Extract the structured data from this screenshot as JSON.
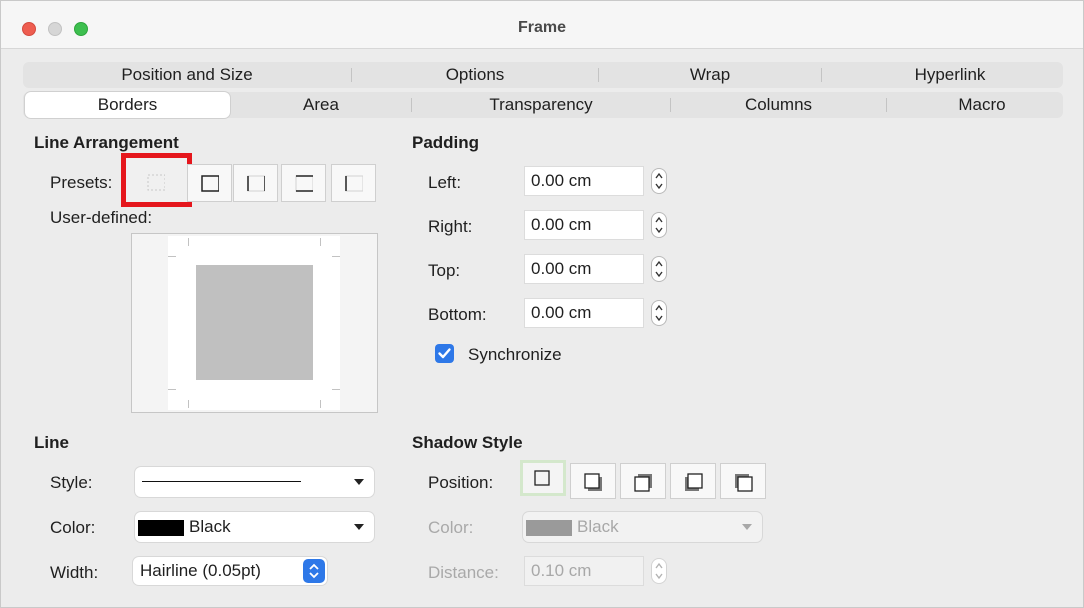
{
  "window": {
    "title": "Frame"
  },
  "tabs": {
    "row1": [
      "Position and Size",
      "Options",
      "Wrap",
      "Hyperlink"
    ],
    "row2": [
      "Borders",
      "Area",
      "Transparency",
      "Columns",
      "Macro"
    ],
    "active": "Borders"
  },
  "line_arrangement": {
    "title": "Line Arrangement",
    "presets_label": "Presets:",
    "presets": [
      "no-borders-icon",
      "all-borders-icon",
      "left-right-borders-icon",
      "top-bottom-borders-icon",
      "left-border-icon"
    ],
    "user_defined_label": "User-defined:"
  },
  "padding": {
    "title": "Padding",
    "left_label": "Left:",
    "left_value": "0.00 cm",
    "right_label": "Right:",
    "right_value": "0.00 cm",
    "top_label": "Top:",
    "top_value": "0.00 cm",
    "bottom_label": "Bottom:",
    "bottom_value": "0.00 cm",
    "synchronize_label": "Synchronize",
    "synchronize_checked": true
  },
  "line": {
    "title": "Line",
    "style_label": "Style:",
    "color_label": "Color:",
    "color_value": "Black",
    "color_hex": "#000000",
    "width_label": "Width:",
    "width_value": "Hairline (0.05pt)"
  },
  "shadow": {
    "title": "Shadow Style",
    "position_label": "Position:",
    "positions": [
      "no-shadow-icon",
      "shadow-bottom-right-icon",
      "shadow-top-right-icon",
      "shadow-bottom-left-icon",
      "shadow-top-left-icon"
    ],
    "color_label": "Color:",
    "color_value": "Black",
    "color_hex": "#9a9a9a",
    "distance_label": "Distance:",
    "distance_value": "0.10 cm"
  },
  "colors": {
    "accent": "#2e78e8",
    "highlight": "#e5161c"
  }
}
